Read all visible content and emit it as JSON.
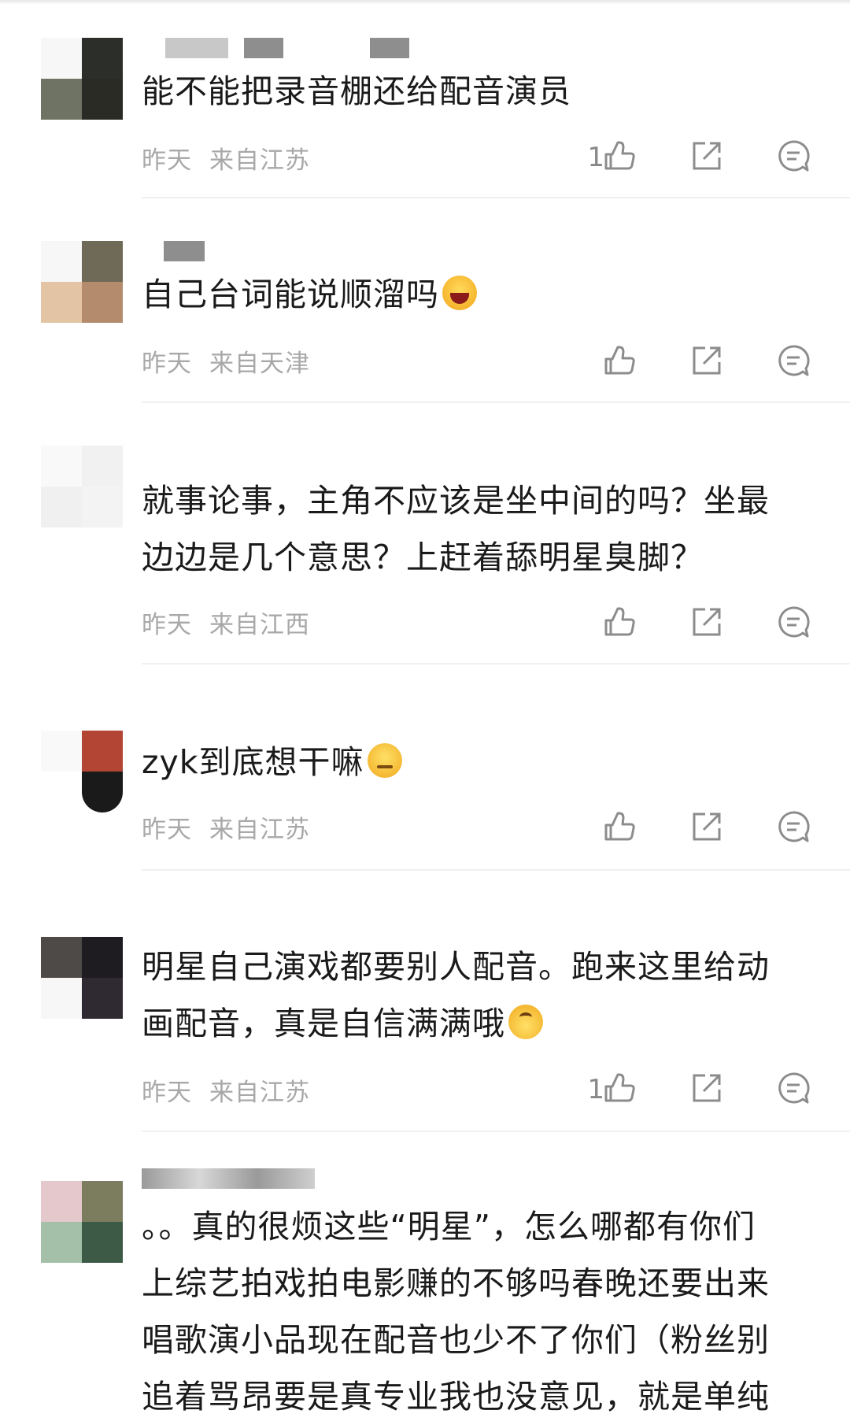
{
  "comments": [
    {
      "text": "能不能把录音棚还给配音演员",
      "time": "昨天",
      "location": "来自江苏",
      "likes": "1"
    },
    {
      "text": "自己台词能说顺溜吗",
      "emoji": "laughing-emoji",
      "time": "昨天",
      "location": "来自天津",
      "likes": ""
    },
    {
      "text": "就事论事，主角不应该是坐中间的吗？坐最\n边边是几个意思？上赶着舔明星臭脚？",
      "time": "昨天",
      "location": "来自江西",
      "likes": ""
    },
    {
      "text": "zyk到底想干嘛",
      "emoji": "sweat-smile-emoji",
      "time": "昨天",
      "location": "来自江苏",
      "likes": ""
    },
    {
      "text": "明星自己演戏都要别人配音。跑来这里给动\n画配音，真是自信满满哦",
      "emoji": "upside-down-face-emoji",
      "time": "昨天",
      "location": "来自江苏",
      "likes": "1"
    },
    {
      "text": "。。真的很烦这些“明星”，怎么哪都有你们\n上综艺拍戏拍电影赚的不够吗春晚还要出来\n唱歌演小品现在配音也少不了你们（粉丝别\n追着骂昂要是真专业我也没意见，就是单纯"
    }
  ],
  "icons": {
    "like": "thumbs-up-icon",
    "share": "share-icon",
    "reply": "comment-icon"
  },
  "colors": {
    "text": "#1a1a1a",
    "meta": "#a8a8a8",
    "icon": "#8c8c8c",
    "divider": "#f0f0f0"
  }
}
